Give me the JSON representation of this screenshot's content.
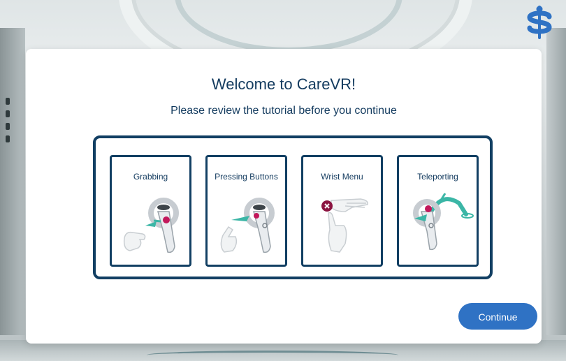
{
  "background": {
    "scene": "vr-hospital-room"
  },
  "logo": {
    "icon": "carevr-logo-icon",
    "color": "#2f72c4"
  },
  "dialog": {
    "title": "Welcome to CareVR!",
    "subtitle": "Please review the tutorial before you continue"
  },
  "tutorials": [
    {
      "label": "Grabbing",
      "icon": "grab-controller-icon"
    },
    {
      "label": "Pressing Buttons",
      "icon": "press-button-controller-icon"
    },
    {
      "label": "Wrist Menu",
      "icon": "wrist-menu-hand-icon"
    },
    {
      "label": "Teleporting",
      "icon": "teleport-controller-icon"
    }
  ],
  "continue_button": {
    "label": "Continue"
  },
  "colors": {
    "accent": "#2f72c4",
    "navy": "#123f63",
    "highlight": "#c2185b",
    "teal": "#3bb6a6"
  }
}
